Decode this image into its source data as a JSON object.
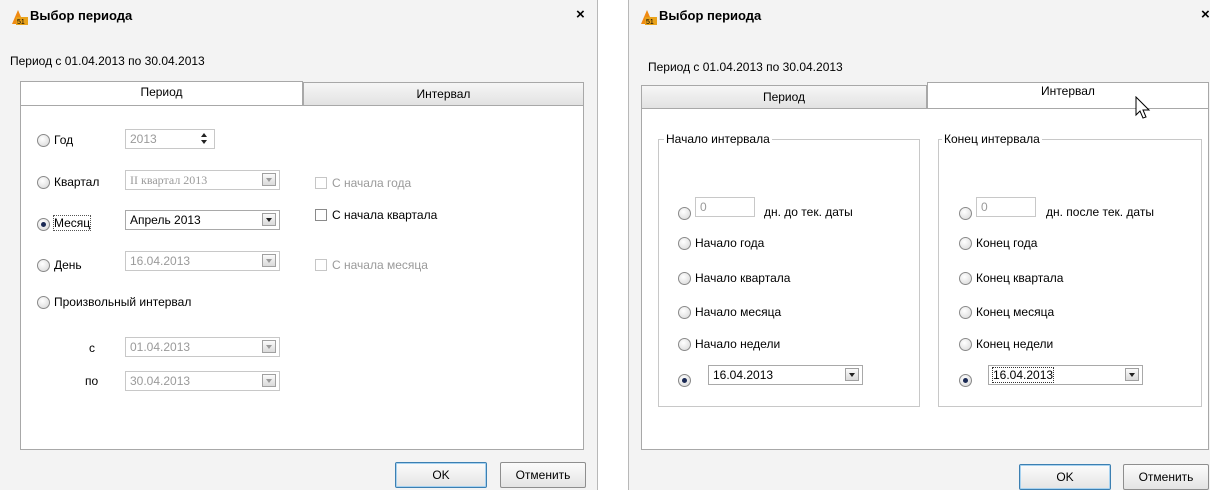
{
  "left_dialog": {
    "title": "Выбор периода",
    "period_text": "Период с 01.04.2013 по 30.04.2013",
    "tabs": [
      {
        "label": "Период",
        "active": true
      },
      {
        "label": "Интервал",
        "active": false
      }
    ],
    "options": {
      "year": {
        "label": "Год",
        "value": "2013"
      },
      "quarter": {
        "label": "Квартал",
        "value": "II  квартал 2013",
        "checkbox": "С начала года"
      },
      "month": {
        "label": "Месяц",
        "value": "Апрель 2013",
        "checkbox": "С начала квартала",
        "selected": true
      },
      "day": {
        "label": "День",
        "value": "16.04.2013",
        "checkbox": "С начала месяца"
      },
      "custom": {
        "label": "Произвольный интервал",
        "from_label": "с",
        "from_value": "01.04.2013",
        "to_label": "по",
        "to_value": "30.04.2013"
      }
    },
    "ok_label": "OK",
    "cancel_label": "Отменить"
  },
  "right_dialog": {
    "title": "Выбор периода",
    "period_text": "Период с 01.04.2013 по 30.04.2013",
    "tabs": [
      {
        "label": "Период",
        "active": false
      },
      {
        "label": "Интервал",
        "active": true
      }
    ],
    "start": {
      "group_label": "Начало интервала",
      "days_value": "0",
      "days_label": "дн. до тек. даты",
      "options": [
        "Начало года",
        "Начало квартала",
        "Начало месяца",
        "Начало недели"
      ],
      "date_value": "16.04.2013"
    },
    "end": {
      "group_label": "Конец интервала",
      "days_value": "0",
      "days_label": "дн. после тек. даты",
      "options": [
        "Конец года",
        "Конец квартала",
        "Конец месяца",
        "Конец недели"
      ],
      "date_value": "16.04.2013"
    },
    "ok_label": "OK",
    "cancel_label": "Отменить"
  },
  "colors": {
    "dialog_bg": "#f3f3f3",
    "panel_bg": "#ffffff",
    "default_button_border": "#3c7fb1",
    "selection": "#3399ff"
  },
  "icons": [
    "app-icon",
    "close-icon",
    "cursor-arrow-icon"
  ]
}
